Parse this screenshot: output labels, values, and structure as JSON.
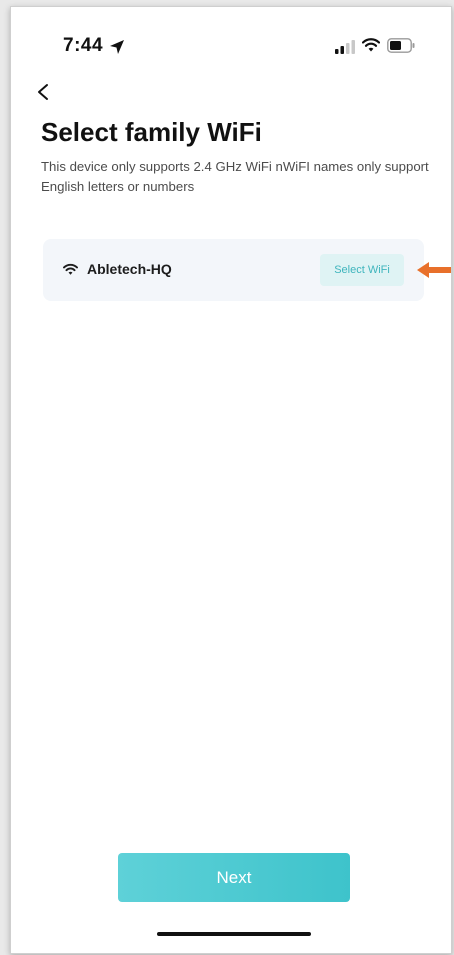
{
  "status_bar": {
    "time": "7:44",
    "icons": [
      "location-arrow-icon",
      "cellular-signal-icon",
      "wifi-icon",
      "battery-icon"
    ]
  },
  "navigation": {
    "back_icon": "chevron-left-icon"
  },
  "header": {
    "title": "Select family WiFi",
    "description": "This device only supports 2.4 GHz WiFi nWiFI names only support English letters or numbers"
  },
  "wifi_card": {
    "icon": "wifi-icon",
    "network_name": "Abletech-HQ",
    "select_label": "Select WiFi"
  },
  "annotation": {
    "icon": "arrow-left-icon",
    "color": "#e8702a"
  },
  "footer": {
    "next_label": "Next"
  },
  "colors": {
    "accent": "#3ec3cb",
    "select_button_bg": "#dff3f4",
    "card_bg": "#f3f6fa"
  }
}
